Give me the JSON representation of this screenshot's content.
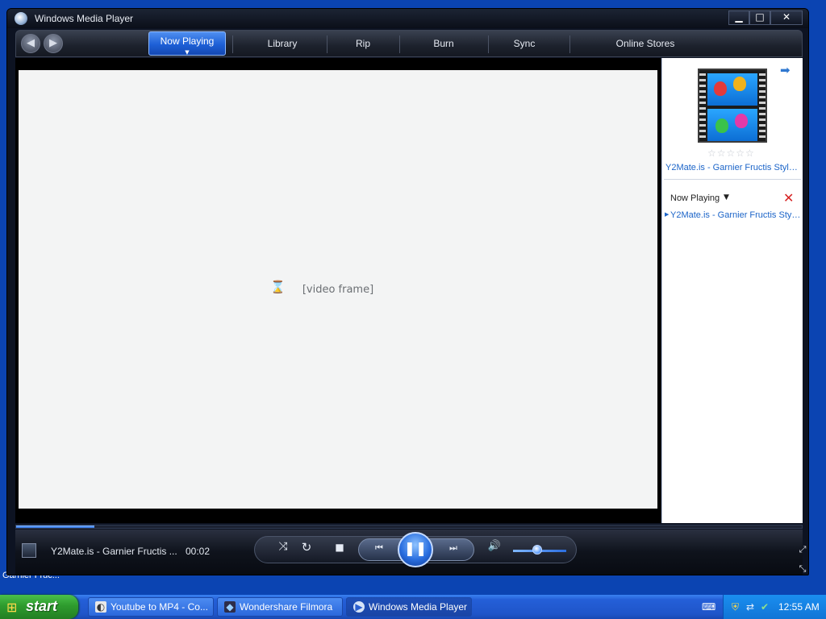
{
  "window": {
    "title": "Windows Media Player"
  },
  "nav": {
    "tabs": [
      {
        "label": "Now Playing"
      },
      {
        "label": "Library"
      },
      {
        "label": "Rip"
      },
      {
        "label": "Burn"
      },
      {
        "label": "Sync"
      },
      {
        "label": "Online Stores"
      }
    ]
  },
  "video": {
    "placeholder": "[video frame]"
  },
  "right_pane": {
    "media_title": "Y2Mate.is - Garnier Fructis Style Cle...",
    "now_playing_label": "Now Playing",
    "playlist": [
      {
        "title": "Y2Mate.is - Garnier Fructis Style Cle..."
      }
    ],
    "rating": 0
  },
  "seek": {
    "progress": 0.1
  },
  "controls": {
    "status_title": "Y2Mate.is - Garnier Fructis ...",
    "elapsed": "00:02",
    "volume": 0.45
  },
  "desktop": {
    "icon_label": "Garnier Fruc..."
  },
  "taskbar": {
    "start_label": "start",
    "tasks": [
      {
        "label": "Youtube to MP4 - Co...",
        "icon": "browser-icon"
      },
      {
        "label": "Wondershare Filmora",
        "icon": "filmora-icon"
      },
      {
        "label": "Windows Media Player",
        "icon": "wmp-icon"
      }
    ],
    "clock": "12:55 AM"
  },
  "colors": {
    "accent": "#1d5fd6",
    "link": "#1b64c8",
    "taskbar": "#245fd8",
    "start": "#2e9b2e"
  }
}
